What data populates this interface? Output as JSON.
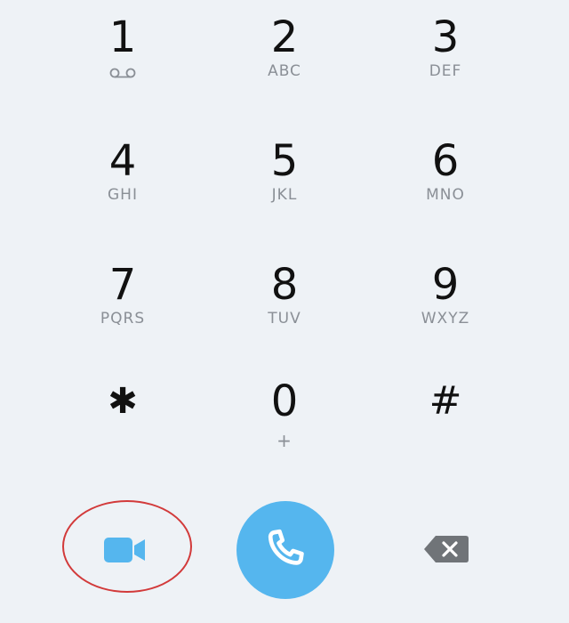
{
  "keypad": {
    "keys": [
      {
        "digit": "1",
        "letters": ""
      },
      {
        "digit": "2",
        "letters": "ABC"
      },
      {
        "digit": "3",
        "letters": "DEF"
      },
      {
        "digit": "4",
        "letters": "GHI"
      },
      {
        "digit": "5",
        "letters": "JKL"
      },
      {
        "digit": "6",
        "letters": "MNO"
      },
      {
        "digit": "7",
        "letters": "PQRS"
      },
      {
        "digit": "8",
        "letters": "TUV"
      },
      {
        "digit": "9",
        "letters": "WXYZ"
      },
      {
        "digit": "✱",
        "letters": ""
      },
      {
        "digit": "0",
        "letters": "+"
      },
      {
        "digit": "#",
        "letters": ""
      }
    ]
  },
  "actions": {
    "video_call_icon": "video-camera-icon",
    "call_icon": "phone-icon",
    "backspace_icon": "backspace-icon"
  },
  "colors": {
    "background": "#eef2f6",
    "accent_blue": "#55b6ee",
    "highlight_red": "#d23a3a",
    "backspace_gray": "#707478"
  }
}
